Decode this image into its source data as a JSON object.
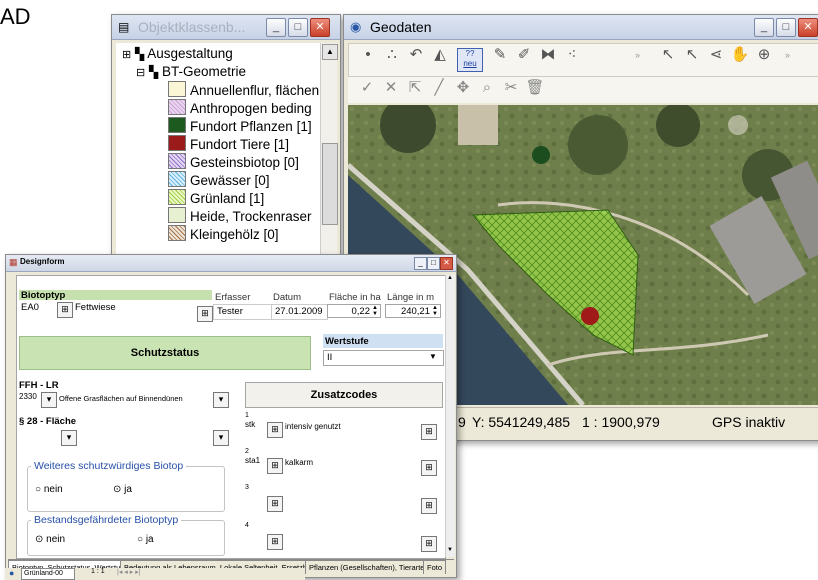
{
  "corner_text": "AD",
  "objekt_window": {
    "title": "Objektklassenb...",
    "tree": [
      {
        "label": "Ausgestaltung",
        "expander": "+",
        "swatch": ""
      },
      {
        "label": "BT-Geometrie",
        "expander": "−",
        "swatch": ""
      },
      {
        "label": "Annuellenflur, flächen",
        "swatch": "#fbf6d6"
      },
      {
        "label": "Anthropogen beding",
        "swatch": "#e9d3ee"
      },
      {
        "label": "Fundort Pflanzen [1]",
        "swatch": "#1c5a1f"
      },
      {
        "label": "Fundort Tiere [1]",
        "swatch": "#9b1a1a"
      },
      {
        "label": "Gesteinsbiotop [0]",
        "swatch": "#c8b3e6"
      },
      {
        "label": "Gewässer [0]",
        "swatch": "#a9d9f2"
      },
      {
        "label": "Grünland [1]",
        "swatch": "#d6ee9a"
      },
      {
        "label": "Heide, Trockenraser",
        "swatch": "#e7f1d1"
      },
      {
        "label": "Kleingehölz [0]",
        "swatch": "#d8bfa6"
      }
    ]
  },
  "geo_window": {
    "title": "Geodaten",
    "status": {
      "y_coord": "Y: 5541249,485",
      "scale": "1 : 1900,979",
      "gps": "GPS inaktiv",
      "x_partial": "9"
    },
    "neu_badge_top": "??",
    "neu_badge_bottom": "neu"
  },
  "design_window": {
    "title": "Designform",
    "biotoptyp_label": "Biotoptyp",
    "biotoptyp_code": "EA0",
    "biotoptyp_value": "Fettwiese",
    "erfasser_label": "Erfasser",
    "erfasser_value": "Tester",
    "datum_label": "Datum",
    "datum_value": "27.01.2009",
    "flaeche_label": "Fläche in ha",
    "flaeche_value": "0,22",
    "laenge_label": "Länge in m",
    "laenge_value": "240,21",
    "schutzstatus_label": "Schutzstatus",
    "wertstufe_label": "Wertstufe",
    "wertstufe_value": "II",
    "ffh_label": "FFH - LR",
    "ffh_code": "2330",
    "ffh_value": "Offene Grasflächen auf Binnendünen",
    "s28_label": "§ 28 - Fläche",
    "zusatzcodes_label": "Zusatzcodes",
    "zusatz": [
      {
        "num": "1",
        "code": "stk",
        "value": "intensiv genutzt"
      },
      {
        "num": "2",
        "code": "sta1",
        "value": "kalkarm"
      },
      {
        "num": "3",
        "code": "",
        "value": ""
      },
      {
        "num": "4",
        "code": "",
        "value": ""
      }
    ],
    "schutzw_label": "Weiteres schutzwürdiges Biotop",
    "schutzw_no": "nein",
    "schutzw_yes": "ja",
    "gefaehrdet_label": "Bestandsgefährdeter Biotoptyp",
    "gefaehrdet_no": "nein",
    "gefaehrdet_yes": "ja",
    "tabs": [
      "Biotoptyp, Schutzstatus, Wertstufe",
      "Bedeutung als Lebensraum, Lokale Seltenheit, Ersetzbarkeit",
      "Pflanzen (Gesellschaften), Tierarten",
      "Foto"
    ],
    "footer_select": "Grünland-00",
    "footer_page": "1 : 1"
  }
}
